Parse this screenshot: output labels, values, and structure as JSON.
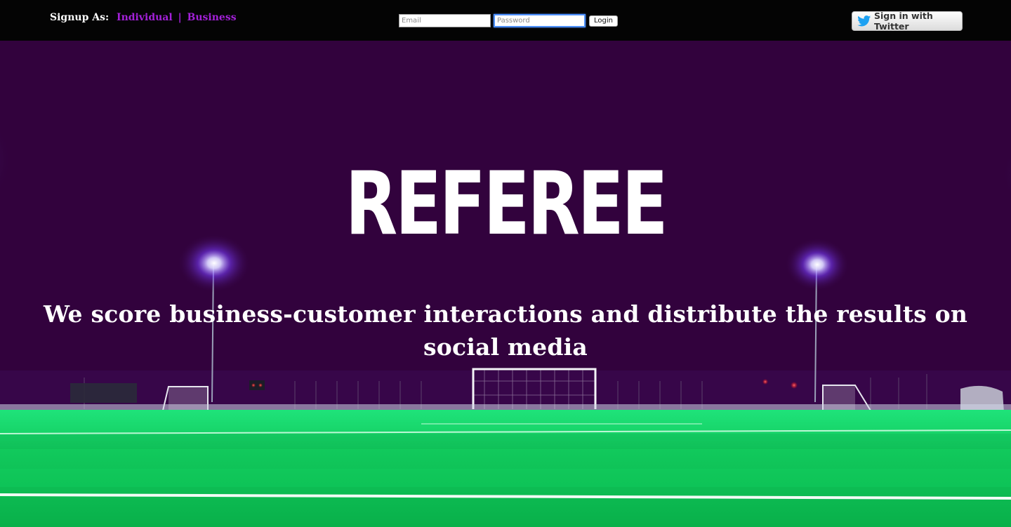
{
  "header": {
    "signup_label": "Signup As:",
    "individual_link": "Individual",
    "separator": "|",
    "business_link": "Business",
    "email_placeholder": "Email",
    "password_placeholder": "Password",
    "login_button": "Login",
    "twitter_button": "Sign in with Twitter",
    "twitter_icon": "twitter-bird-icon"
  },
  "hero": {
    "title": "REFEREE",
    "tagline": "We score business-customer interactions and distribute the results on social media"
  },
  "colors": {
    "topbar_bg": "#040404",
    "link_purple": "#a321d8",
    "sky_purple": "#32023d",
    "turf_green": "#0fd35f",
    "twitter_blue": "#1da1f2"
  }
}
